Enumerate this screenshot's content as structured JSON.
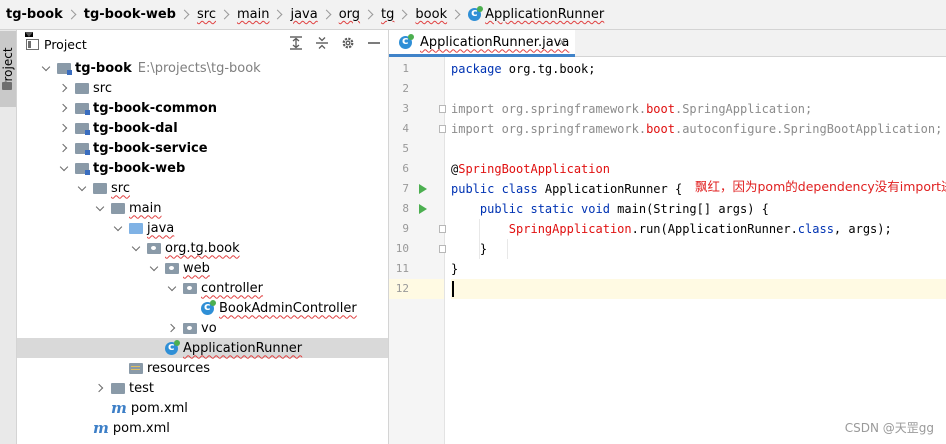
{
  "breadcrumbs": [
    {
      "label": "tg-book",
      "bold": true
    },
    {
      "label": "tg-book-web",
      "bold": true
    },
    {
      "label": "src",
      "wavy": true
    },
    {
      "label": "main",
      "wavy": true
    },
    {
      "label": "java",
      "wavy": true
    },
    {
      "label": "org",
      "wavy": true
    },
    {
      "label": "tg",
      "wavy": true
    },
    {
      "label": "book",
      "wavy": true
    },
    {
      "label": "ApplicationRunner",
      "icon": "class-icon",
      "wavy": true
    }
  ],
  "side_strip": {
    "label": "Project"
  },
  "project_panel": {
    "title": "Project",
    "tree": [
      {
        "indent": 0,
        "arrow": "down",
        "icon": "module-folder",
        "label": "tg-book",
        "bold": true,
        "path": "E:\\projects\\tg-book"
      },
      {
        "indent": 1,
        "arrow": "right",
        "icon": "folder",
        "label": "src"
      },
      {
        "indent": 1,
        "arrow": "right",
        "icon": "module-folder",
        "label": "tg-book-common",
        "bold": true
      },
      {
        "indent": 1,
        "arrow": "right",
        "icon": "module-folder",
        "label": "tg-book-dal",
        "bold": true
      },
      {
        "indent": 1,
        "arrow": "right",
        "icon": "module-folder",
        "label": "tg-book-service",
        "bold": true
      },
      {
        "indent": 1,
        "arrow": "down",
        "icon": "module-folder",
        "label": "tg-book-web",
        "bold": true
      },
      {
        "indent": 2,
        "arrow": "down",
        "icon": "folder",
        "label": "src",
        "wavy": true
      },
      {
        "indent": 3,
        "arrow": "down",
        "icon": "folder",
        "label": "main",
        "wavy": true
      },
      {
        "indent": 4,
        "arrow": "down",
        "icon": "blue-folder",
        "label": "java",
        "wavy": true
      },
      {
        "indent": 5,
        "arrow": "down",
        "icon": "package",
        "label": "org.tg.book",
        "wavy": true
      },
      {
        "indent": 6,
        "arrow": "down",
        "icon": "package",
        "label": "web",
        "wavy": true
      },
      {
        "indent": 7,
        "arrow": "down",
        "icon": "package",
        "label": "controller",
        "wavy": true
      },
      {
        "indent": 8,
        "arrow": "none",
        "icon": "class",
        "label": "BookAdminController",
        "wavy": true
      },
      {
        "indent": 7,
        "arrow": "right",
        "icon": "package",
        "label": "vo"
      },
      {
        "indent": 6,
        "arrow": "none",
        "icon": "class",
        "label": "ApplicationRunner",
        "wavy": true,
        "selected": true
      },
      {
        "indent": 4,
        "arrow": "none",
        "icon": "resources-folder",
        "label": "resources"
      },
      {
        "indent": 3,
        "arrow": "right",
        "icon": "folder",
        "label": "test"
      },
      {
        "indent": 3,
        "arrow": "none",
        "icon": "maven",
        "label": "pom.xml"
      },
      {
        "indent": 2,
        "arrow": "none",
        "icon": "maven",
        "label": "pom.xml"
      }
    ]
  },
  "editor": {
    "tab": {
      "label": "ApplicationRunner.java",
      "close": "✕"
    },
    "lines": [
      {
        "n": "1",
        "html": "<span class='kw'>package</span> org.tg.book;"
      },
      {
        "n": "2",
        "html": ""
      },
      {
        "n": "3",
        "html": "<span class='gray'>import org.springframework.</span><span class='red'>boot</span><span class='gray'>.SpringApplication;</span>"
      },
      {
        "n": "4",
        "html": "<span class='gray'>import org.springframework.</span><span class='red'>boot</span><span class='gray'>.autoconfigure.SpringBootApplication;</span>"
      },
      {
        "n": "5",
        "html": ""
      },
      {
        "n": "6",
        "html": "@<span class='red'>SpringBootApplication</span>"
      },
      {
        "n": "7",
        "html": "<span class='kw'>public class</span> ApplicationRunner {"
      },
      {
        "n": "8",
        "html": "    <span class='kw'>public static void</span> main(String[] args) {"
      },
      {
        "n": "9",
        "html": "        <span class='red'>SpringApplication</span>.run(ApplicationRunner.<span class='kw'>class</span>, args);"
      },
      {
        "n": "10",
        "html": "    }"
      },
      {
        "n": "11",
        "html": "}"
      },
      {
        "n": "12",
        "html": ""
      }
    ],
    "note": "飘红，因为pom的dependency没有import进",
    "watermark": "CSDN @天罡gg"
  }
}
